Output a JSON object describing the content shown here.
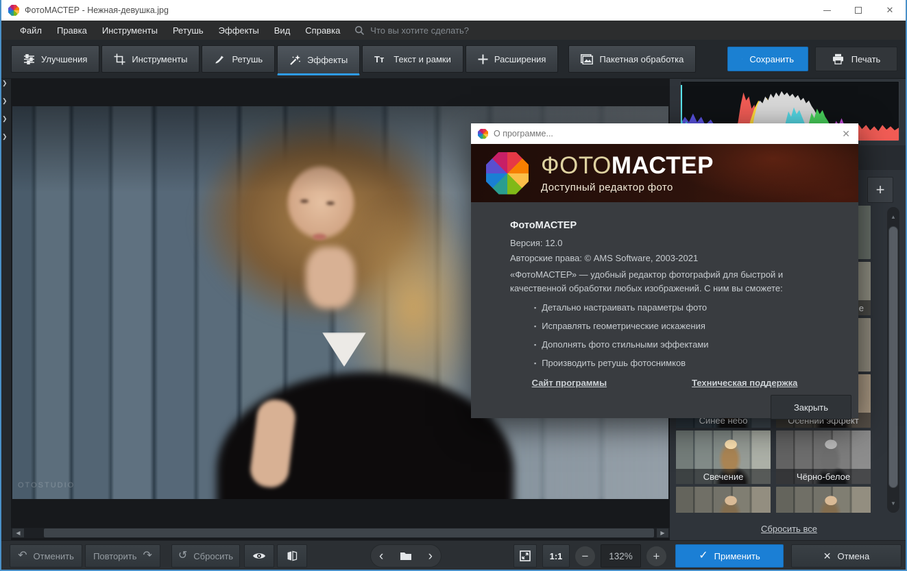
{
  "window": {
    "title": "ФотоМАСТЕР - Нежная-девушка.jpg"
  },
  "menu": {
    "items": [
      "Файл",
      "Правка",
      "Инструменты",
      "Ретушь",
      "Эффекты",
      "Вид",
      "Справка"
    ],
    "search_placeholder": "Что вы хотите сделать?"
  },
  "tabs": {
    "improve": "Улучшения",
    "tools": "Инструменты",
    "retouch": "Ретушь",
    "effects": "Эффекты",
    "text_frames": "Текст и рамки",
    "extensions": "Расширения",
    "batch": "Пакетная обработка"
  },
  "header_actions": {
    "save": "Сохранить",
    "print": "Печать"
  },
  "effects_panel": {
    "add_button": "+",
    "thumbs": {
      "partial_label": "е",
      "blue_sky": "Синее небо",
      "autumn": "Осенний эффект",
      "glow": "Свечение",
      "bw": "Чёрно-белое"
    },
    "reset_all": "Сбросить все"
  },
  "canvas": {
    "watermark": "OTOSTUDIO"
  },
  "dialog": {
    "title": "О программе...",
    "brand": {
      "part1": "ФОТО",
      "part2": "МАСТЕР",
      "tagline": "Доступный редактор фото"
    },
    "app_name": "ФотоМАСТЕР",
    "version": "Версия: 12.0",
    "copyright": "Авторские права: © AMS Software, 2003-2021",
    "description": "«ФотоМАСТЕР» — удобный редактор фотографий для быстрой и качественной обработки любых изображений. С ним вы сможете:",
    "bullet": "▪",
    "features": [
      "Детально настраивать параметры фото",
      "Исправлять геометрические искажения",
      "Дополнять фото стильными эффектами",
      "Производить ретушь фотоснимков"
    ],
    "links": {
      "site": "Сайт программы",
      "support": "Техническая поддержка"
    },
    "close_button": "Закрыть"
  },
  "bottom_bar": {
    "undo": "Отменить",
    "redo": "Повторить",
    "reset": "Сбросить",
    "ratio": "1:1",
    "zoom": "132%",
    "apply": "Применить",
    "cancel": "Отмена"
  },
  "icons": {
    "close": "✕",
    "nav_prev": "‹",
    "nav_next": "›",
    "panel_expand": "❯",
    "undo": "↶",
    "redo": "↷",
    "reset": "↺",
    "minus": "−",
    "plus": "+",
    "check": "✓",
    "up": "▲",
    "down": "▼",
    "left_small": "◀",
    "right_small": "▶"
  },
  "colors": {
    "accent_blue": "#1b7fd5",
    "panel_dark": "#2f343a",
    "histogram_bg": "#0f1215"
  }
}
